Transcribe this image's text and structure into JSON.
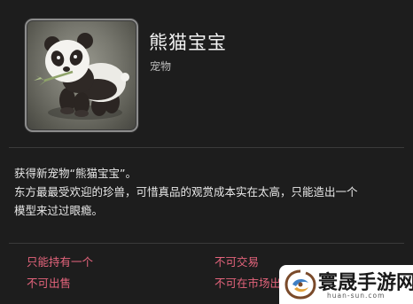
{
  "item": {
    "name": "熊猫宝宝",
    "type": "宠物",
    "icon": "panda-minion-icon"
  },
  "description": {
    "line1": "获得新宠物“熊猫宝宝”。",
    "line2": "东方最最受欢迎的珍兽，可惜真品的观赏成本实在太高，只能造出一个",
    "line3": "模型来过过眼瘾。"
  },
  "restrictions": {
    "unique": "只能持有一个",
    "untradable": "不可交易",
    "unsellable": "不可出售",
    "market_prohibited": "不可在市场出售"
  },
  "watermark": {
    "text": "寰晟手游网",
    "url": "huan-sun.com"
  },
  "colors": {
    "background": "#1d1d1d",
    "restriction_text": "#e4647c",
    "divider": "#3a3a3a"
  }
}
